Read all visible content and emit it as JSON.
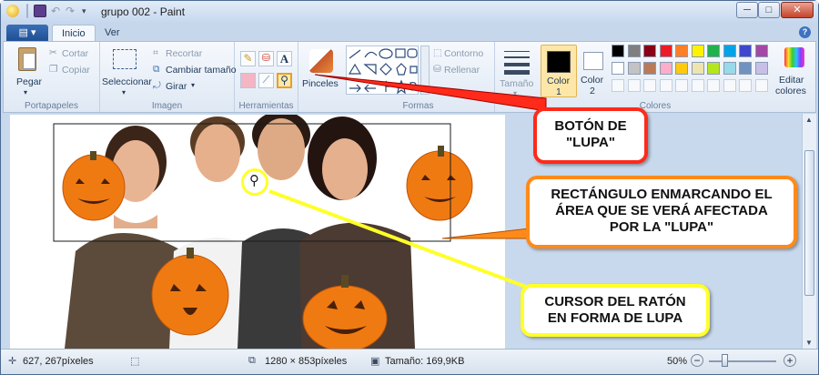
{
  "window": {
    "title": "grupo 002 - Paint",
    "controls": {
      "minimize": "─",
      "maximize": "□",
      "close": "✕"
    }
  },
  "tabs": {
    "file_label": "▤ ▾",
    "home": "Inicio",
    "view": "Ver",
    "help": "?"
  },
  "ribbon": {
    "clipboard": {
      "paste": "Pegar",
      "cut": "Cortar",
      "copy": "Copiar",
      "group": "Portapapeles"
    },
    "image": {
      "select": "Seleccionar",
      "crop": "Recortar",
      "resize": "Cambiar tamaño",
      "rotate": "Girar",
      "group": "Imagen"
    },
    "tools": {
      "group": "Herramientas"
    },
    "brushes": {
      "label": "Pinceles"
    },
    "shapes": {
      "outline": "Contorno",
      "fill": "Rellenar",
      "group": "Formas"
    },
    "size": {
      "label": "Tamaño"
    },
    "colors": {
      "color1": "Color",
      "color1_num": "1",
      "color2": "Color",
      "color2_num": "2",
      "edit": "Editar",
      "edit2": "colores",
      "group": "Colores",
      "palette_row1": [
        "#000000",
        "#7f7f7f",
        "#880015",
        "#ed1c24",
        "#ff7f27",
        "#fff200",
        "#22b14c",
        "#00a2e8",
        "#3f48cc",
        "#a349a4"
      ],
      "palette_row2": [
        "#ffffff",
        "#c3c3c3",
        "#b97a57",
        "#ffaec9",
        "#ffc90e",
        "#efe4b0",
        "#b5e61d",
        "#99d9ea",
        "#7092be",
        "#c8bfe7"
      ]
    }
  },
  "callouts": {
    "zoom_button": {
      "line1": "BOTÓN DE",
      "line2": "\"LUPA\"",
      "color": "#ff2a1a"
    },
    "rectangle": {
      "line1": "RECTÁNGULO ENMARCANDO EL",
      "line2": "ÁREA QUE SE VERÁ AFECTADA",
      "line3": "POR LA \"LUPA\"",
      "color": "#ff8a1a"
    },
    "cursor": {
      "line1": "CURSOR DEL RATÓN",
      "line2": "EN FORMA DE LUPA",
      "color": "#ffff2a"
    }
  },
  "status": {
    "cursor_pos": "627, 267píxeles",
    "image_size": "1280 × 853píxeles",
    "file_size": "Tamaño: 169,9KB",
    "zoom": "50%"
  }
}
